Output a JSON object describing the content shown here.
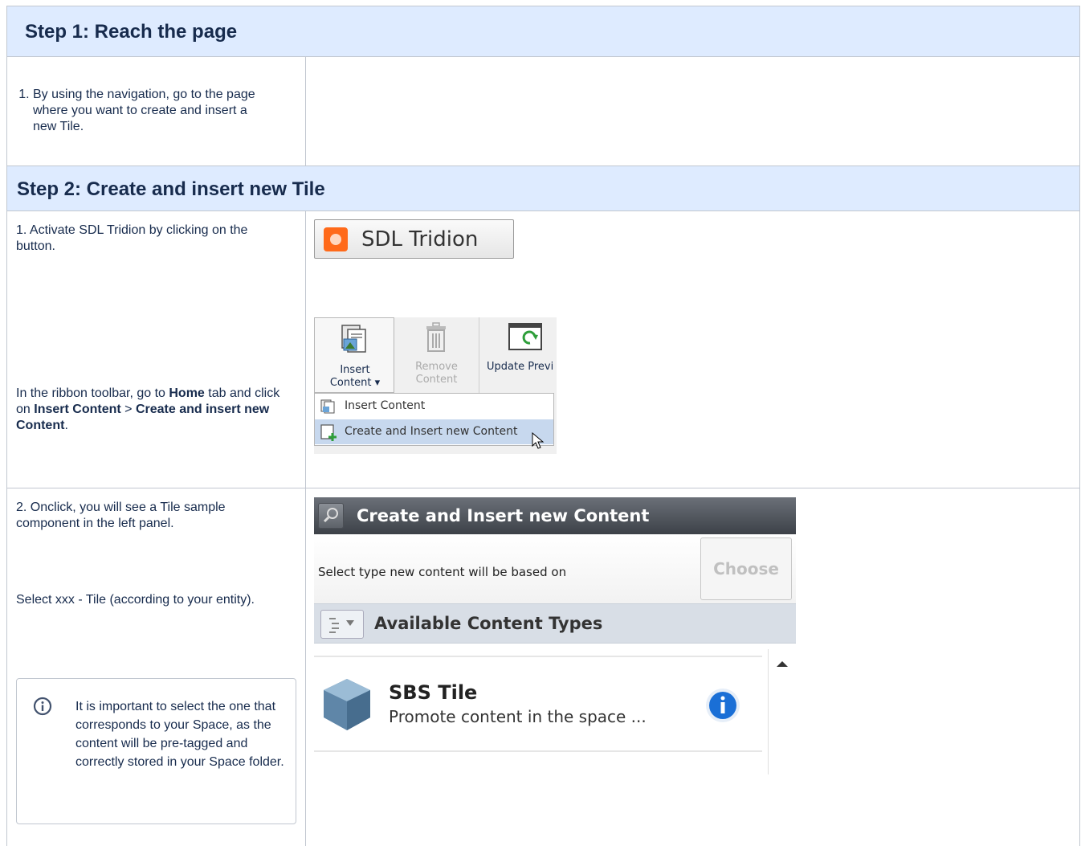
{
  "step1": {
    "title": "Step 1: Reach the page",
    "instruction": "By using the navigation, go to the page where you want to create and insert a new Tile."
  },
  "step2": {
    "title": "Step 2: Create and insert new Tile",
    "row1": {
      "activate": "1. Activate SDL Tridion by clicking on the button.",
      "ribbon_pre": "In the ribbon toolbar, go to ",
      "ribbon_home": "Home",
      "ribbon_mid1": " tab and click on ",
      "ribbon_insert": "Insert Content",
      "ribbon_mid2": " > ",
      "ribbon_create": "Create and insert new Content",
      "ribbon_end": "."
    },
    "row2": {
      "onclick": "2. Onclick, you will see a Tile sample component in the left panel.",
      "select": "Select xxx - Tile (according to your entity).",
      "note": "It is important to select the one that corresponds to your Space, as the content will be pre-tagged and correctly stored in your Space folder."
    }
  },
  "tridion_button": {
    "label": "SDL Tridion"
  },
  "ribbon": {
    "insert_line1": "Insert",
    "insert_line2": "Content",
    "remove_line1": "Remove",
    "remove_line2": "Content",
    "update": "Update Previ",
    "menu_insert": "Insert Content",
    "menu_create": "Create and Insert new Content"
  },
  "panel": {
    "title": "Create and Insert new Content",
    "select_label": "Select type new content will be based on",
    "choose": "Choose",
    "content_types": "Available Content Types",
    "item_title": "SBS Tile",
    "item_desc": "Promote content in the space ..."
  },
  "colors": {
    "header_bg": "#deebff",
    "tridion_orange": "#ff6a1a",
    "info_blue": "#1a6fd6"
  }
}
